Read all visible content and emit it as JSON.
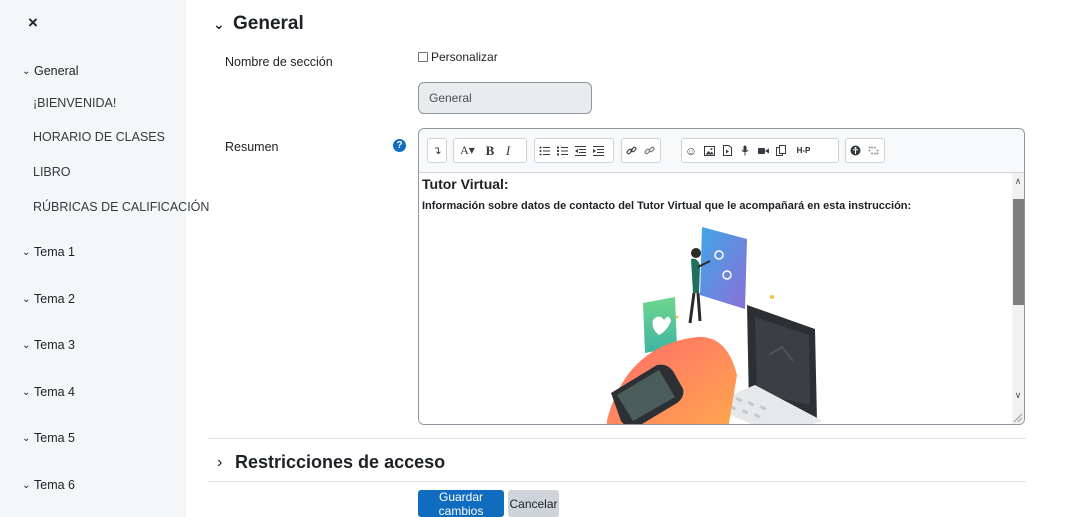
{
  "sidebar": {
    "close_label": "×",
    "sections": [
      {
        "label": "General",
        "expanded": true
      },
      {
        "label": "¡BIENVENIDA!"
      },
      {
        "label": "HORARIO DE CLASES"
      },
      {
        "label": "LIBRO"
      },
      {
        "label": "RÚBRICAS DE CALIFICACIÓN"
      },
      {
        "label": "Tema 1"
      },
      {
        "label": "Tema 2"
      },
      {
        "label": "Tema 3"
      },
      {
        "label": "Tema 4"
      },
      {
        "label": "Tema 5"
      },
      {
        "label": "Tema 6"
      }
    ]
  },
  "form": {
    "general_heading": "General",
    "section_name_label": "Nombre de sección",
    "custom_checkbox_label": "Personalizar",
    "custom_checkbox_checked": false,
    "section_name_value": "General",
    "summary_label": "Resumen",
    "editor": {
      "content_title": "Tutor Virtual:",
      "content_text": "Información sobre datos de contacto del Tutor Virtual que le acompañará en esta instrucción:"
    },
    "restrictions_heading": "Restricciones de acceso"
  },
  "buttons": {
    "save": "Guardar cambios",
    "cancel": "Cancelar"
  },
  "colors": {
    "primary": "#0f6cbf",
    "sidebar_bg": "#f5f6f7",
    "input_bg": "#e9ecef"
  }
}
